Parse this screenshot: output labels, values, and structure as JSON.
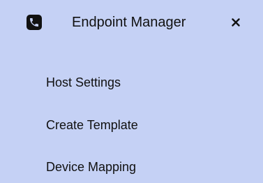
{
  "menu": {
    "title": "Endpoint Manager",
    "app_icon": "phone-icon",
    "close_icon": "close-icon",
    "items": [
      {
        "label": "Host Settings"
      },
      {
        "label": "Create Template"
      },
      {
        "label": "Device Mapping"
      }
    ]
  },
  "colors": {
    "background": "#c5d1f5",
    "text": "#111111",
    "icon": "#111111"
  }
}
